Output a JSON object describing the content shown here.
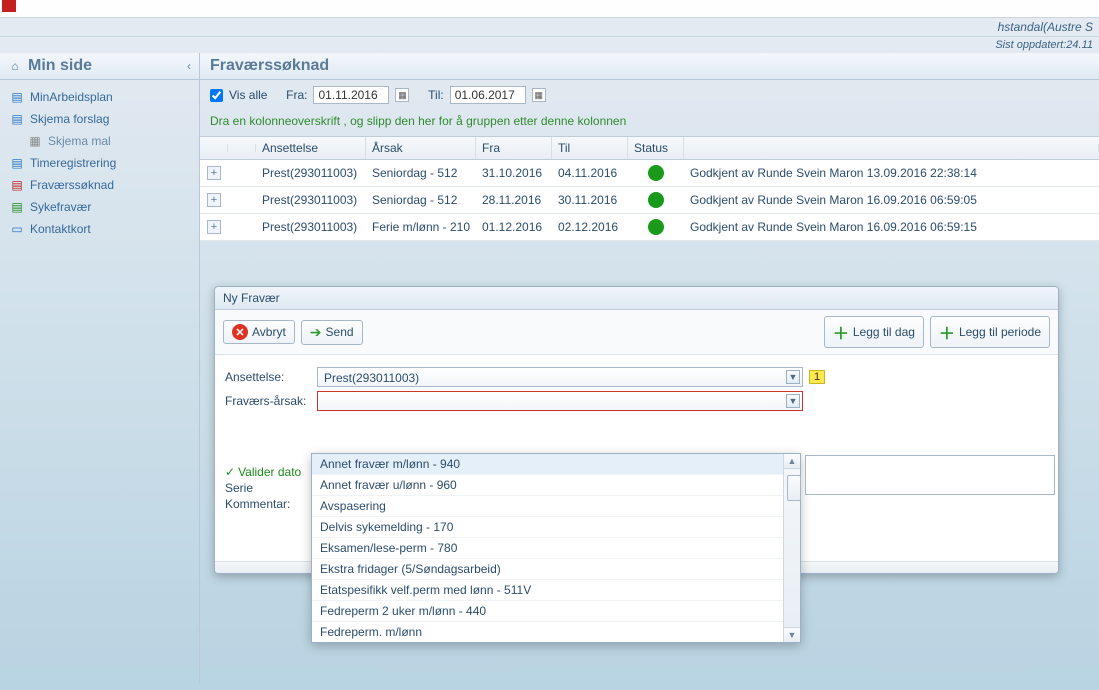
{
  "header": {
    "user_line": "hstandal(Austre S",
    "updated_line": "Sist oppdatert:24.11"
  },
  "sidebar": {
    "title": "Min side",
    "items": [
      {
        "label": "MinArbeidsplan",
        "icon": "calendar-icon"
      },
      {
        "label": "Skjema forslag",
        "icon": "calendar-icon"
      },
      {
        "label": "Skjema mal",
        "icon": "grid-icon",
        "child": true
      },
      {
        "label": "Timeregistrering",
        "icon": "clock-icon"
      },
      {
        "label": "Fraværssøknad",
        "icon": "calendar-red-icon"
      },
      {
        "label": "Sykefravær",
        "icon": "calendar-green-icon"
      },
      {
        "label": "Kontaktkort",
        "icon": "card-icon"
      }
    ]
  },
  "page": {
    "title": "Fraværssøknad",
    "show_all_label": "Vis alle",
    "from_label": "Fra:",
    "to_label": "Til:",
    "from_value": "01.11.2016",
    "to_value": "01.06.2017",
    "group_hint": "Dra en kolonneoverskrift , og slipp den her for å gruppen etter denne kolonnen"
  },
  "grid": {
    "headers": {
      "ansettelse": "Ansettelse",
      "arsak": "Årsak",
      "fra": "Fra",
      "til": "Til",
      "status": "Status"
    },
    "rows": [
      {
        "ansettelse": "Prest(293011003)",
        "arsak": "Seniordag - 512",
        "fra": "31.10.2016",
        "til": "04.11.2016",
        "detail": "Godkjent av Runde Svein Maron 13.09.2016 22:38:14"
      },
      {
        "ansettelse": "Prest(293011003)",
        "arsak": "Seniordag - 512",
        "fra": "28.11.2016",
        "til": "30.11.2016",
        "detail": "Godkjent av Runde Svein Maron 16.09.2016 06:59:05"
      },
      {
        "ansettelse": "Prest(293011003)",
        "arsak": "Ferie m/lønn - 210",
        "fra": "01.12.2016",
        "til": "02.12.2016",
        "detail": "Godkjent av Runde Svein Maron 16.09.2016 06:59:15"
      }
    ]
  },
  "dialog": {
    "title": "Ny Fravær",
    "buttons": {
      "avbryt": "Avbryt",
      "send": "Send",
      "legg_dag": "Legg til dag",
      "legg_periode": "Legg til periode"
    },
    "form": {
      "ansettelse_label": "Ansettelse:",
      "ansettelse_value": "Prest(293011003)",
      "ansettelse_badge": "1",
      "arsak_label": "Fraværs-årsak:",
      "valider_label": "Valider dato",
      "serie_label": "Serie",
      "kommentar_label": "Kommentar:"
    },
    "arsak_options": [
      "Annet fravær m/lønn - 940",
      "Annet fravær u/lønn - 960",
      "Avspasering",
      "Delvis sykemelding - 170",
      "Eksamen/lese-perm - 780",
      "Ekstra fridager (5/Søndagsarbeid)",
      "Etatspesifikk velf.perm med lønn - 511V",
      "Fedreperm 2 uker m/lønn - 440",
      "Fedreperm. m/lønn"
    ]
  }
}
